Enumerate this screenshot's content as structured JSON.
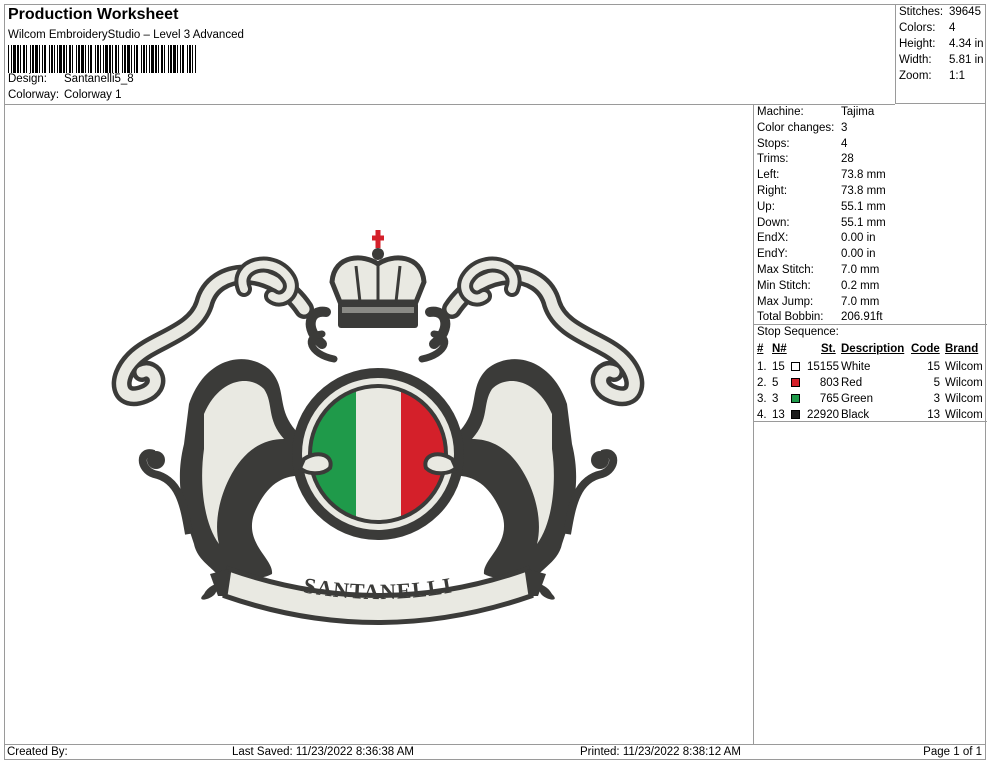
{
  "header": {
    "title": "Production Worksheet",
    "software": "Wilcom EmbroideryStudio – Level 3 Advanced",
    "design_label": "Design:",
    "design_value": "Santanelli5_8",
    "colorway_label": "Colorway:",
    "colorway_value": "Colorway 1"
  },
  "stats": [
    {
      "label": "Stitches:",
      "value": "39645"
    },
    {
      "label": "Colors:",
      "value": "4"
    },
    {
      "label": "Height:",
      "value": "4.34 in"
    },
    {
      "label": "Width:",
      "value": "5.81 in"
    },
    {
      "label": "Zoom:",
      "value": "1:1"
    }
  ],
  "machine": [
    {
      "label": "Machine:",
      "value": "Tajima"
    },
    {
      "label": "Color changes:",
      "value": "3"
    },
    {
      "label": "Stops:",
      "value": "4"
    },
    {
      "label": "Trims:",
      "value": "28"
    },
    {
      "label": "Left:",
      "value": "73.8 mm"
    },
    {
      "label": "Right:",
      "value": "73.8 mm"
    },
    {
      "label": "Up:",
      "value": "55.1 mm"
    },
    {
      "label": "Down:",
      "value": "55.1 mm"
    },
    {
      "label": "EndX:",
      "value": "0.00 in"
    },
    {
      "label": "EndY:",
      "value": "0.00 in"
    },
    {
      "label": "Max Stitch:",
      "value": "7.0 mm"
    },
    {
      "label": "Min Stitch:",
      "value": "0.2 mm"
    },
    {
      "label": "Max Jump:",
      "value": "7.0 mm"
    },
    {
      "label": "Total Bobbin:",
      "value": "206.91ft"
    }
  ],
  "stop_sequence": {
    "title": "Stop Sequence:",
    "headers": {
      "num": "#",
      "n": "N#",
      "st": "St.",
      "desc": "Description",
      "code": "Code",
      "brand": "Brand"
    },
    "rows": [
      {
        "num": "1.",
        "n": "15",
        "color": "#ffffff",
        "st": "15155",
        "desc": "White",
        "code": "15",
        "brand": "Wilcom"
      },
      {
        "num": "2.",
        "n": "5",
        "color": "#d4202a",
        "st": "803",
        "desc": "Red",
        "code": "5",
        "brand": "Wilcom"
      },
      {
        "num": "3.",
        "n": "3",
        "color": "#1f9a4a",
        "st": "765",
        "desc": "Green",
        "code": "3",
        "brand": "Wilcom"
      },
      {
        "num": "4.",
        "n": "13",
        "color": "#1a1a1a",
        "st": "22920",
        "desc": "Black",
        "code": "13",
        "brand": "Wilcom"
      }
    ]
  },
  "design": {
    "banner_text": "SANTANELLI",
    "colors": {
      "white": "#e9e9e2",
      "red": "#d4202a",
      "green": "#1f9a4a",
      "black": "#3b3b39"
    }
  },
  "footer": {
    "created": "Created By:",
    "saved": "Last Saved: 11/23/2022 8:36:38 AM",
    "printed": "Printed: 11/23/2022 8:38:12 AM",
    "page": "Page 1 of 1"
  }
}
